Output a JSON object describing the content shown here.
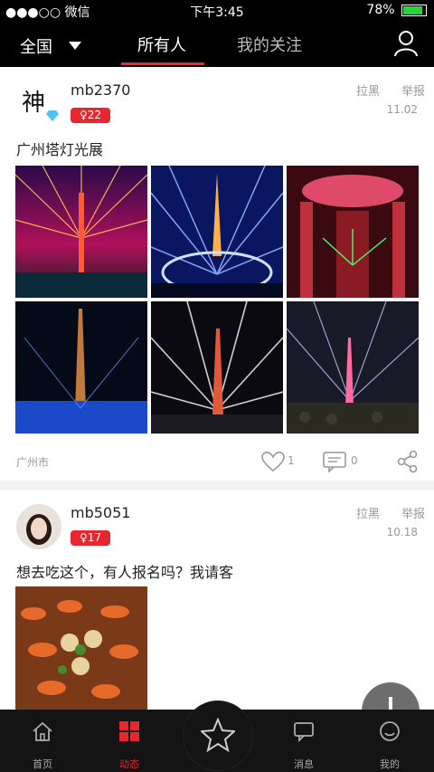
{
  "status": {
    "carrier": "微信",
    "signal": "●●●○○",
    "time": "下午3:45",
    "battery": "78%",
    "battery_level": 0.78
  },
  "nav": {
    "region": "全国",
    "tabs": [
      "所有人",
      "我的关注"
    ],
    "active_tab": 0
  },
  "posts": [
    {
      "username": "mb2370",
      "level": "♀22",
      "actions": [
        "拉黑",
        "举报"
      ],
      "date": "11.02",
      "text": "广州塔灯光展",
      "location": "广州市",
      "likes": "1",
      "comments": "0"
    },
    {
      "username": "mb5051",
      "level": "♀17",
      "actions": [
        "拉黑",
        "举报"
      ],
      "date": "10.18",
      "text": "想去吃这个，有人报名吗？我请客"
    }
  ],
  "tabbar": {
    "items": [
      "首页",
      "动态",
      "消息",
      "我的"
    ],
    "active": 1
  },
  "colors": {
    "accent": "#e8262f",
    "background": "#f2f2f2",
    "bars": "#000000"
  }
}
